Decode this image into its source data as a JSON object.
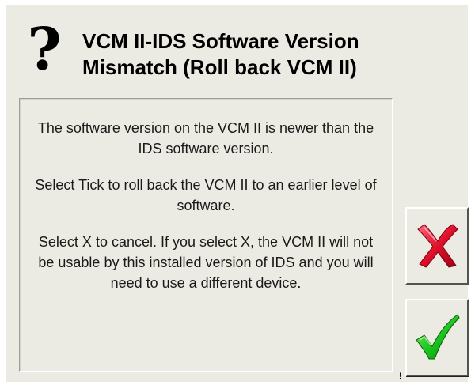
{
  "dialog": {
    "title": "VCM II-IDS Software Version\nMismatch (Roll back VCM II)",
    "question_glyph": "?",
    "message": {
      "paragraph_1": "The software version on the VCM II is newer than the IDS software version.",
      "paragraph_2": "Select Tick to roll back the VCM II to an earlier level of software.",
      "paragraph_3": "Select X to cancel.  If you select X, the VCM II will not be usable by this installed version of IDS and you will need to use a different device."
    },
    "stray_mark": "!"
  },
  "buttons": {
    "cancel_icon": "red-x-icon",
    "confirm_icon": "green-check-icon"
  },
  "colors": {
    "dialog_background": "#ecebe3",
    "cancel_red": "#e0102a",
    "confirm_green": "#19c21a"
  }
}
